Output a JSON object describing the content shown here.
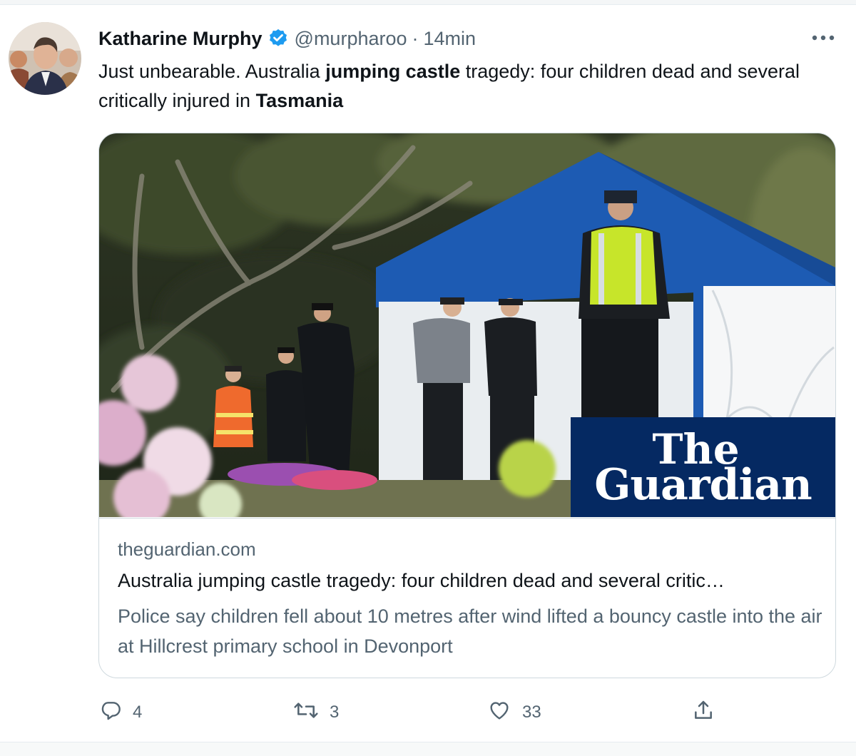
{
  "author": {
    "name": "Katharine Murphy",
    "handle": "@murpharoo",
    "separator": "·",
    "time": "14min",
    "avatar_icon": "profile-photo",
    "verified_icon": "verified-badge-icon"
  },
  "tweet": {
    "text_parts": [
      {
        "text": "Just unbearable. Australia ",
        "bold": false
      },
      {
        "text": "jumping castle",
        "bold": true
      },
      {
        "text": " tragedy: four children dead and several critically injured in ",
        "bold": false
      },
      {
        "text": "Tasmania",
        "bold": true
      }
    ]
  },
  "card": {
    "brand_line1": "The",
    "brand_line2": "Guardian",
    "domain": "theguardian.com",
    "title": "Australia jumping castle tragedy: four children dead and several critic…",
    "description": "Police say children fell about 10 metres after wind lifted a bouncy castle into the air at Hillcrest primary school in Devonport"
  },
  "actions": {
    "replies": "4",
    "retweets": "3",
    "likes": "33",
    "icons": [
      "reply-icon",
      "retweet-icon",
      "like-icon",
      "share-icon"
    ]
  },
  "colors": {
    "text": "#0f1419",
    "secondary": "#536471",
    "border": "#cfd9de",
    "verified": "#1d9bf0",
    "brand_box": "#052962"
  }
}
